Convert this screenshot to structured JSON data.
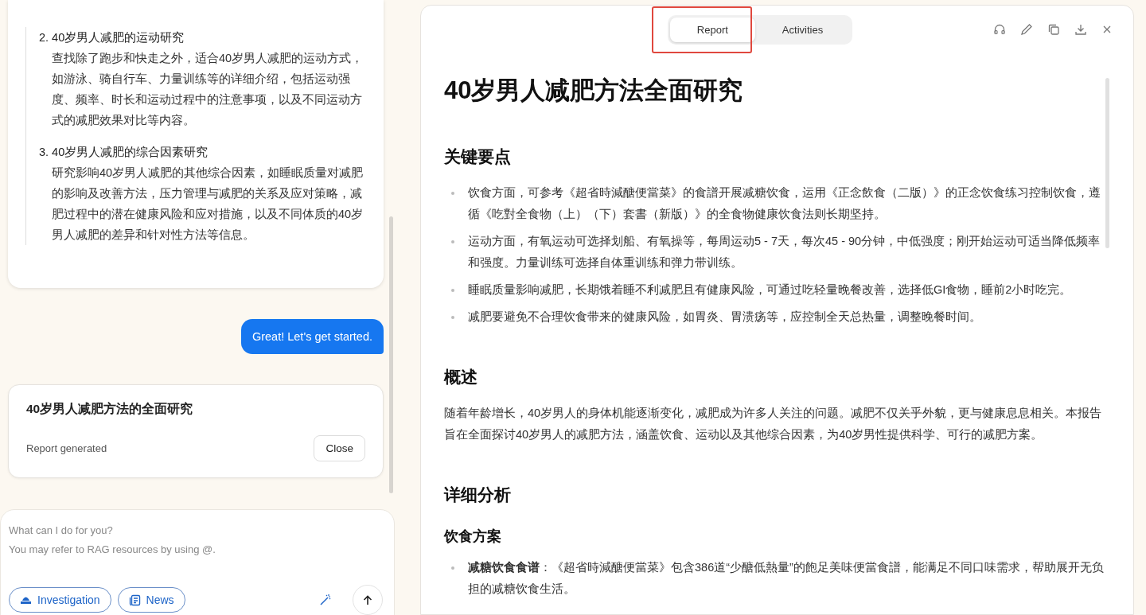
{
  "chat": {
    "plan_items": [
      {
        "number": "2.",
        "title": "40岁男人减肥的运动研究",
        "description": "查找除了跑步和快走之外，适合40岁男人减肥的运动方式，如游泳、骑自行车、力量训练等的详细介绍，包括运动强度、频率、时长和运动过程中的注意事项，以及不同运动方式的减肥效果对比等内容。"
      },
      {
        "number": "3.",
        "title": "40岁男人减肥的综合因素研究",
        "description": "研究影响40岁男人减肥的其他综合因素，如睡眠质量对减肥的影响及改善方法，压力管理与减肥的关系及应对策略，减肥过程中的潜在健康风险和应对措施，以及不同体质的40岁男人减肥的差异和针对性方法等信息。"
      }
    ],
    "user_message": "Great! Let's get started.",
    "report_card": {
      "title": "40岁男人减肥方法的全面研究",
      "status": "Report generated",
      "button": "Close"
    },
    "input": {
      "placeholder": "What can I do for you?\nYou may refer to RAG resources by using @.",
      "modes": [
        {
          "label": "Investigation",
          "kind": "investigation"
        },
        {
          "label": "News",
          "kind": "news"
        }
      ]
    }
  },
  "report": {
    "tabs": [
      {
        "label": "Report",
        "selected": true,
        "highlighted": true
      },
      {
        "label": "Activities",
        "selected": false,
        "highlighted": false
      }
    ],
    "title": "40岁男人减肥方法全面研究",
    "sections": [
      {
        "kind": "bullets",
        "heading": "关键要点",
        "items": [
          "饮食方面，可参考《超省時減醣便當菜》的食譜开展减糖饮食，运用《正念飲食（二版）》的正念饮食练习控制饮食，遵循《吃對全食物（上）（下）套書（新版）》的全食物健康饮食法则长期坚持。",
          "运动方面，有氧运动可选择划船、有氧操等，每周运动5 - 7天，每次45 - 90分钟，中低强度；刚开始运动可适当降低频率和强度。力量训练可选择自体重训练和弹力带训练。",
          "睡眠质量影响减肥，长期饿着睡不利减肥且有健康风险，可通过吃轻量晚餐改善，选择低GI食物，睡前2小时吃完。",
          "减肥要避免不合理饮食带来的健康风险，如胃炎、胃溃疡等，应控制全天总热量，调整晚餐时间。"
        ]
      },
      {
        "kind": "paragraph",
        "heading": "概述",
        "text": "随着年龄增长，40岁男人的身体机能逐渐变化，减肥成为许多人关注的问题。减肥不仅关乎外貌，更与健康息息相关。本报告旨在全面探讨40岁男人的减肥方法，涵盖饮食、运动以及其他综合因素，为40岁男性提供科学、可行的减肥方案。"
      },
      {
        "kind": "subsections",
        "heading": "详细分析",
        "subsections": [
          {
            "heading": "饮食方案",
            "items": [
              "**减糖饮食食谱**：《超省時減醣便當菜》包含386道“少醣低熱量”的飽足美味便當食譜，能满足不同口味需求，帮助展开无负担的减糖饮食生活。"
            ]
          }
        ]
      }
    ]
  }
}
